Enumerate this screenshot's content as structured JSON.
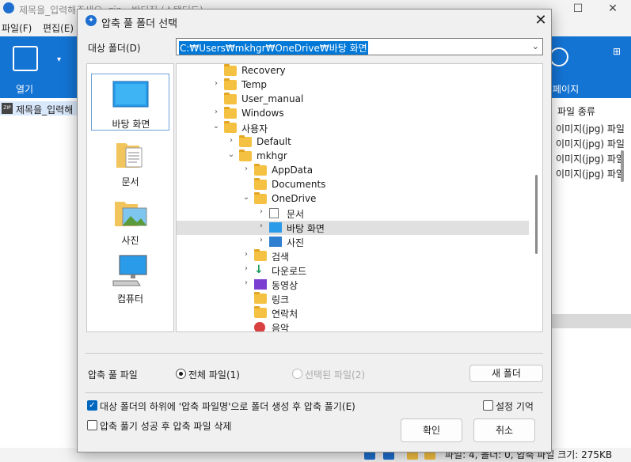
{
  "bg": {
    "title": "제목을_입력해주세요. zip - 반디집 (스탠더드)",
    "menu": [
      "파일(F)",
      "편집(E)"
    ],
    "open_label": "열기",
    "ribbon_right_label": "페이지",
    "zip_label": "ZIP",
    "zip_file": "제목을_입력해",
    "col_header": "파일 종류",
    "file_types": [
      "이미지(jpg) 파일",
      "이미지(jpg) 파일",
      "이미지(jpg) 파일",
      "이미지(jpg) 파일"
    ],
    "status": "파일: 4, 폴더: 0, 압축 파일 크기: 275KB"
  },
  "dialog": {
    "title": "압축 풀 폴더 선택",
    "target_label": "대상 폴더(D)",
    "target_path": "C:₩Users₩mkhgr₩OneDrive₩바탕 화면",
    "places": [
      "바탕 화면",
      "문서",
      "사진",
      "컴퓨터"
    ],
    "tree": [
      {
        "label": "Recovery",
        "icon": "folder-icon",
        "twisty": ""
      },
      {
        "label": "Temp",
        "icon": "folder-icon",
        "twisty": "›"
      },
      {
        "label": "User_manual",
        "icon": "folder-icon",
        "twisty": ""
      },
      {
        "label": "Windows",
        "icon": "folder-icon",
        "twisty": "›"
      },
      {
        "label": "사용자",
        "icon": "folder-icon",
        "twisty": "⌄"
      },
      {
        "label": "Default",
        "icon": "folder-icon",
        "twisty": "›"
      },
      {
        "label": "mkhgr",
        "icon": "folder-icon",
        "twisty": "⌄"
      },
      {
        "label": "AppData",
        "icon": "folder-icon",
        "twisty": "›"
      },
      {
        "label": "Documents",
        "icon": "folder-icon",
        "twisty": ""
      },
      {
        "label": "OneDrive",
        "icon": "folder-icon",
        "twisty": "⌄"
      },
      {
        "label": "문서",
        "icon": "document-icon",
        "twisty": "›"
      },
      {
        "label": "바탕 화면",
        "icon": "desktop-icon",
        "twisty": "›"
      },
      {
        "label": "사진",
        "icon": "picture-icon",
        "twisty": "›"
      },
      {
        "label": "검색",
        "icon": "folder-icon",
        "twisty": "›"
      },
      {
        "label": "다운로드",
        "icon": "download-icon",
        "twisty": "›"
      },
      {
        "label": "동영상",
        "icon": "video-icon",
        "twisty": "›"
      },
      {
        "label": "링크",
        "icon": "folder-icon",
        "twisty": ""
      },
      {
        "label": "연락처",
        "icon": "folder-icon",
        "twisty": ""
      },
      {
        "label": "음악",
        "icon": "music-icon",
        "twisty": ""
      }
    ],
    "selected_tree_item": "바탕 화면",
    "extract_label": "압축 풀 파일",
    "radio_all": "전체 파일(1)",
    "radio_selected": "선택된 파일(2)",
    "new_folder": "새 폴더",
    "check_subfolder": "대상 폴더의 하위에 '압축 파일명'으로 폴더 생성 후 압축 풀기(E)",
    "check_remember": "설정 기억",
    "check_delete": "압축 풀기 성공 후 압축 파일 삭제",
    "ok": "확인",
    "cancel": "취소"
  },
  "colors": {
    "accent": "#0078d7",
    "ribbon": "#1474d4",
    "folder": "#f5c142"
  }
}
